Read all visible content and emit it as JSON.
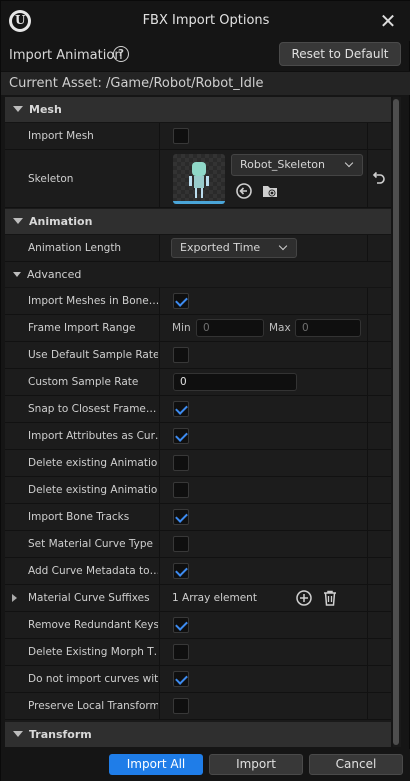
{
  "window": {
    "title": "FBX Import Options",
    "close_glyph": "✕"
  },
  "header": {
    "label": "Import Animation",
    "help_glyph": "?",
    "reset_label": "Reset to Default"
  },
  "asset": {
    "text": "Current Asset:  /Game/Robot/Robot_Idle"
  },
  "mesh": {
    "category": "Mesh",
    "import_mesh": {
      "label": "Import Mesh",
      "checked": false
    },
    "skeleton": {
      "label": "Skeleton",
      "value": "Robot_Skeleton"
    }
  },
  "animation": {
    "category": "Animation",
    "length": {
      "label": "Animation Length",
      "value": "Exported Time"
    },
    "advanced": "Advanced",
    "rows": [
      {
        "label": "Import Meshes in Bone…",
        "type": "check",
        "checked": true
      },
      {
        "label": "Frame Import Range",
        "type": "range",
        "min_label": "Min",
        "min_value": "0",
        "max_label": "Max",
        "max_value": "0"
      },
      {
        "label": "Use Default Sample Rate",
        "type": "check",
        "checked": false
      },
      {
        "label": "Custom Sample Rate",
        "type": "number",
        "value": "0"
      },
      {
        "label": "Snap to Closest Frame…",
        "type": "check",
        "checked": true
      },
      {
        "label": "Import Attributes as Cur…",
        "type": "check",
        "checked": true
      },
      {
        "label": "Delete existing Animatio…",
        "type": "check",
        "checked": false
      },
      {
        "label": "Delete existing Animatio…",
        "type": "check",
        "checked": false
      },
      {
        "label": "Import Bone Tracks",
        "type": "check",
        "checked": true
      },
      {
        "label": "Set Material Curve Type",
        "type": "check",
        "checked": false
      },
      {
        "label": "Add Curve Metadata to…",
        "type": "check",
        "checked": true
      },
      {
        "label": "Material Curve Suffixes",
        "type": "array",
        "value": "1 Array element"
      },
      {
        "label": "Remove Redundant Keys",
        "type": "check",
        "checked": true
      },
      {
        "label": "Delete Existing Morph T…",
        "type": "check",
        "checked": false
      },
      {
        "label": "Do not import curves wit…",
        "type": "check",
        "checked": true
      },
      {
        "label": "Preserve Local Transform",
        "type": "check",
        "checked": false
      }
    ]
  },
  "transform": {
    "category": "Transform"
  },
  "footer": {
    "import_all": "Import All",
    "import": "Import",
    "cancel": "Cancel"
  },
  "colors": {
    "accent": "#1f7de8",
    "check": "#3d8bf0"
  }
}
